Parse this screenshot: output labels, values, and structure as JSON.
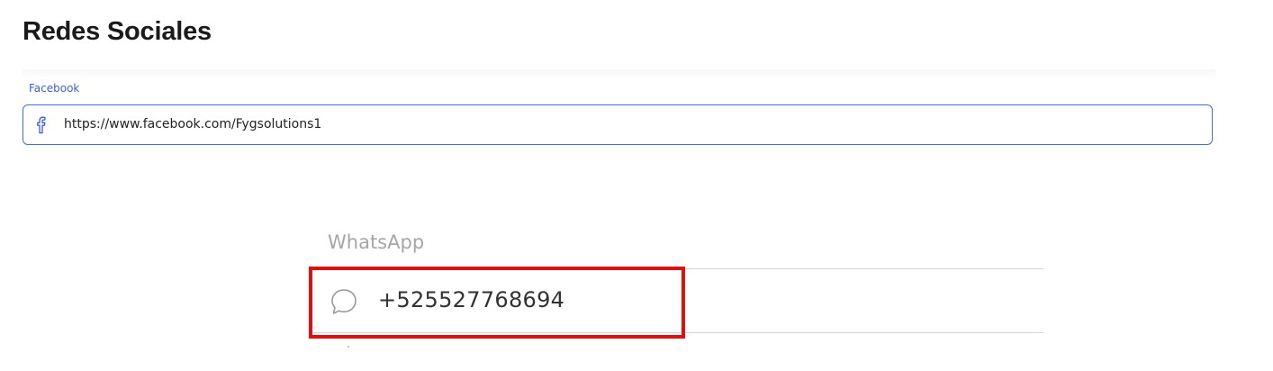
{
  "section": {
    "title": "Redes Sociales"
  },
  "facebook": {
    "label": "Facebook",
    "value": "https://www.facebook.com/Fygsolutions1",
    "icon": "facebook-icon",
    "accent": "#3d5fd6"
  },
  "whatsapp": {
    "label": "WhatsApp",
    "value": "+525527768694",
    "icon": "chat-bubble-icon",
    "highlight_color": "#e01010"
  }
}
